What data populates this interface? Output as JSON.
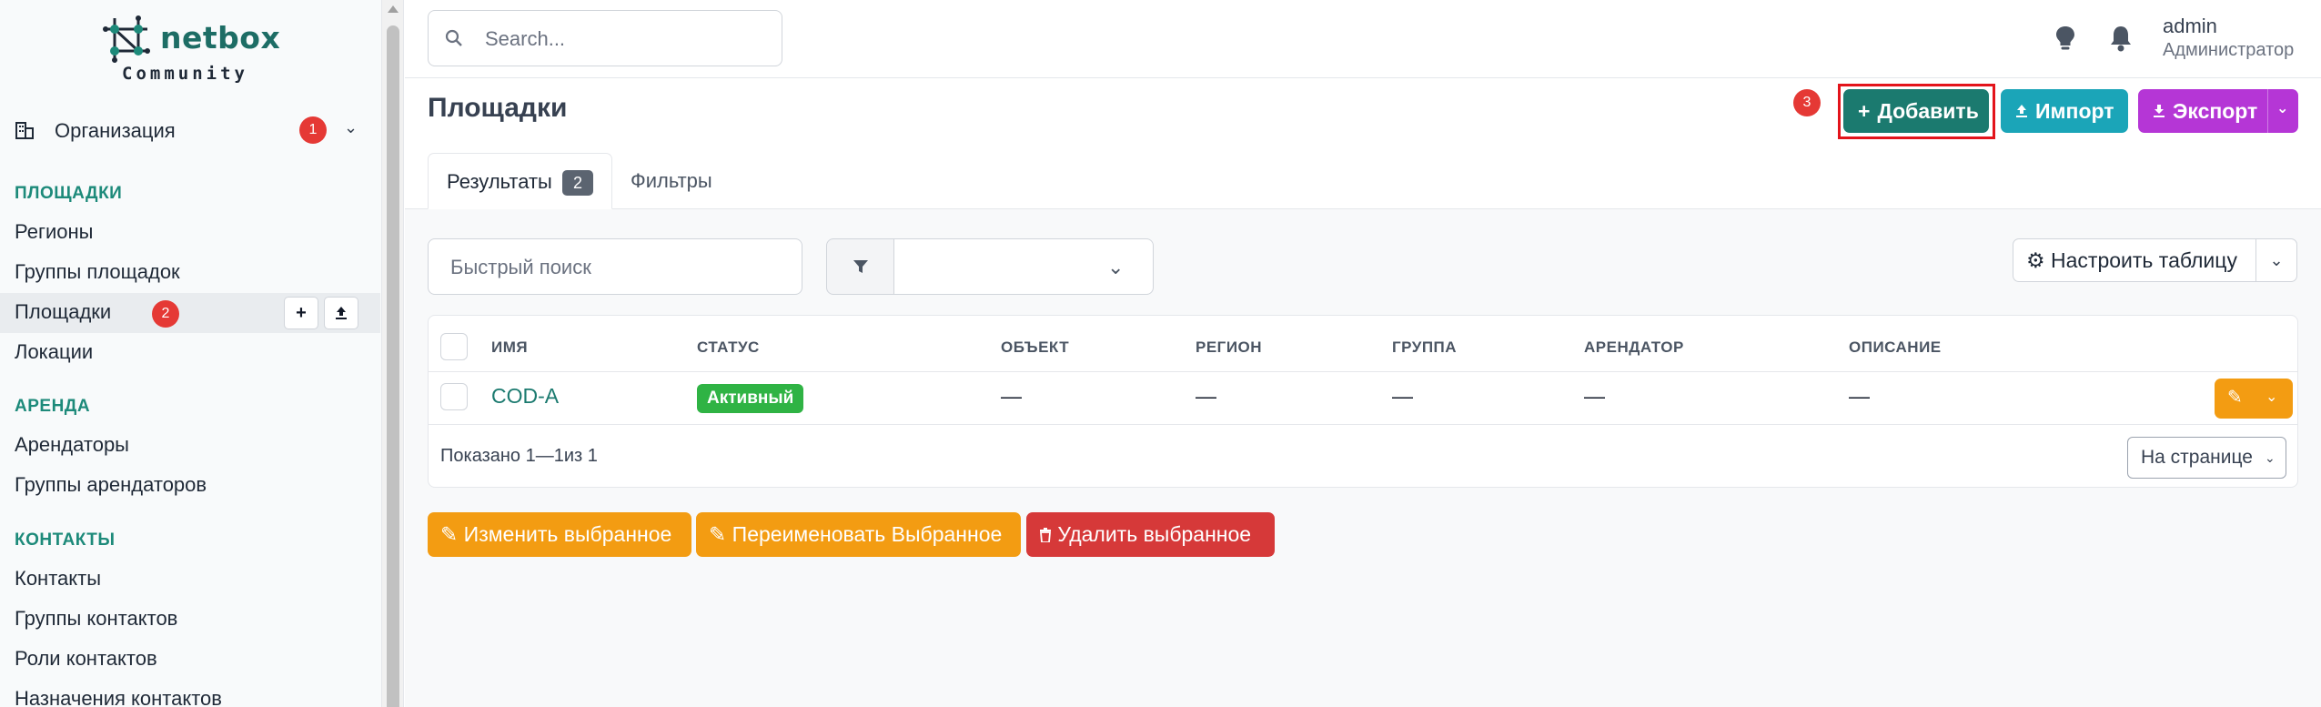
{
  "brand": {
    "name": "netbox",
    "edition": "Community"
  },
  "sidebar": {
    "org": {
      "label": "Организация",
      "badge": "1"
    },
    "sections": [
      {
        "title": "ПЛОЩАДКИ",
        "items": [
          "Регионы",
          "Группы площадок",
          "Площадки",
          "Локации"
        ]
      },
      {
        "title": "АРЕНДА",
        "items": [
          "Арендаторы",
          "Группы арендаторов"
        ]
      },
      {
        "title": "КОНТАКТЫ",
        "items": [
          "Контакты",
          "Группы контактов",
          "Роли контактов",
          "Назначения контактов"
        ]
      }
    ],
    "active_badge": "2"
  },
  "header": {
    "search_placeholder": "Search...",
    "user": "admin",
    "role": "Администратор"
  },
  "page": {
    "title": "Площадки",
    "step_badge": "3",
    "add_label": "Добавить",
    "import_label": "Импорт",
    "export_label": "Экспорт"
  },
  "tabs": {
    "results": "Результаты",
    "results_count": "2",
    "filters": "Фильтры"
  },
  "toolbar": {
    "quick_search_placeholder": "Быстрый поиск",
    "configure_label": "Настроить таблицу"
  },
  "table": {
    "columns": [
      "ИМЯ",
      "СТАТУС",
      "ОБЪЕКТ",
      "РЕГИОН",
      "ГРУППА",
      "АРЕНДАТОР",
      "ОПИСАНИЕ"
    ],
    "rows": [
      {
        "name": "COD-A",
        "status": "Активный",
        "object": "—",
        "region": "—",
        "group": "—",
        "tenant": "—",
        "description": "—"
      }
    ],
    "shown": "Показано 1—1из 1",
    "per_page": "На странице"
  },
  "bulk": {
    "edit": "Изменить выбранное",
    "rename": "Переименовать Выбранное",
    "delete": "Удалить выбранное"
  },
  "colors": {
    "accent": "#1b7a6f",
    "info": "#1ba5b8",
    "purple": "#b536d6",
    "warning": "#f39c12",
    "danger": "#d63939",
    "success": "#2fb344"
  }
}
